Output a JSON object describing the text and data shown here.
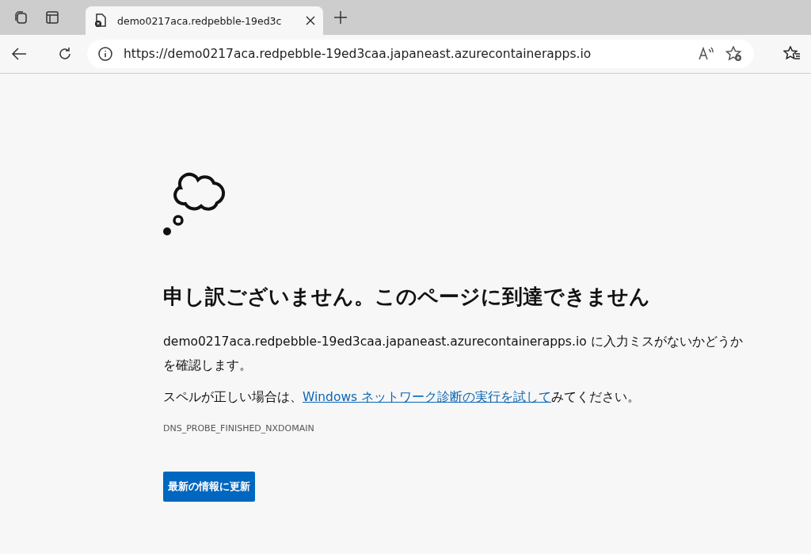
{
  "browser": {
    "tab": {
      "title": "demo0217aca.redpebble-19ed3c",
      "selected": true
    },
    "address": "https://demo0217aca.redpebble-19ed3caa.japaneast.azurecontainerapps.io"
  },
  "error": {
    "heading": "申し訳ございません。このページに到達できません",
    "check_text": "demo0217aca.redpebble-19ed3caa.japaneast.azurecontainerapps.io に入力ミスがないかどうかを確認します。",
    "suggestion": {
      "before": "スペルが正しい場合は、",
      "link": "Windows ネットワーク診断の実行を試して",
      "after": "みてください。"
    },
    "code": "DNS_PROBE_FINISHED_NXDOMAIN",
    "button": "最新の情報に更新"
  }
}
